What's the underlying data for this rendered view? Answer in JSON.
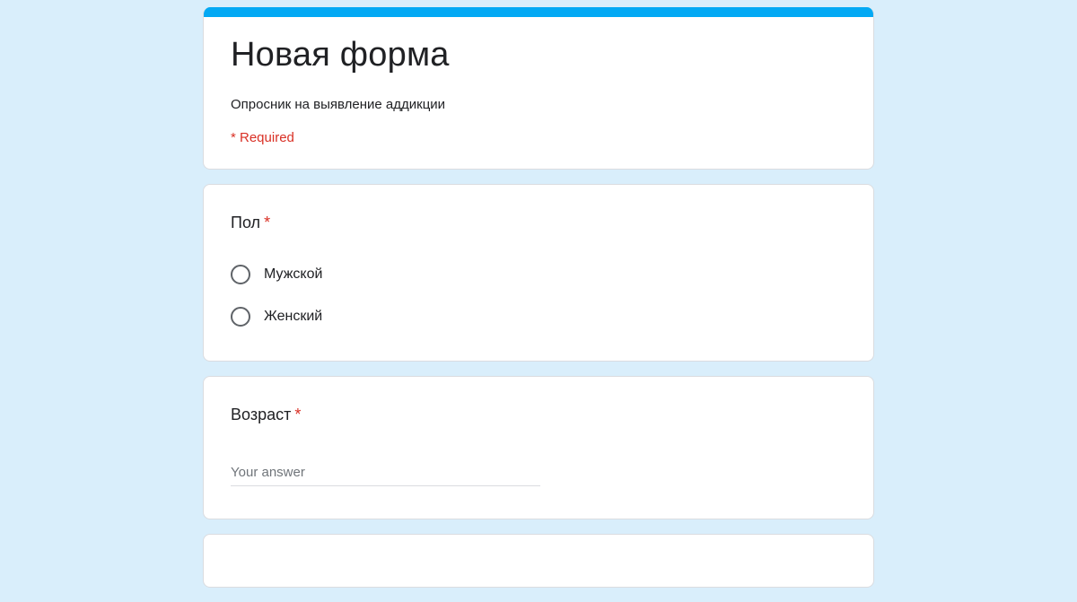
{
  "form": {
    "title": "Новая форма",
    "description": "Опросник на выявление аддикции",
    "required_note": "* Required",
    "accent_color": "#03a9f4",
    "background_color": "#d9eefb"
  },
  "questions": {
    "gender": {
      "title": "Пол",
      "required_mark": "*",
      "options": [
        {
          "label": "Мужской"
        },
        {
          "label": "Женский"
        }
      ]
    },
    "age": {
      "title": "Возраст",
      "required_mark": "*",
      "placeholder": "Your answer"
    }
  }
}
